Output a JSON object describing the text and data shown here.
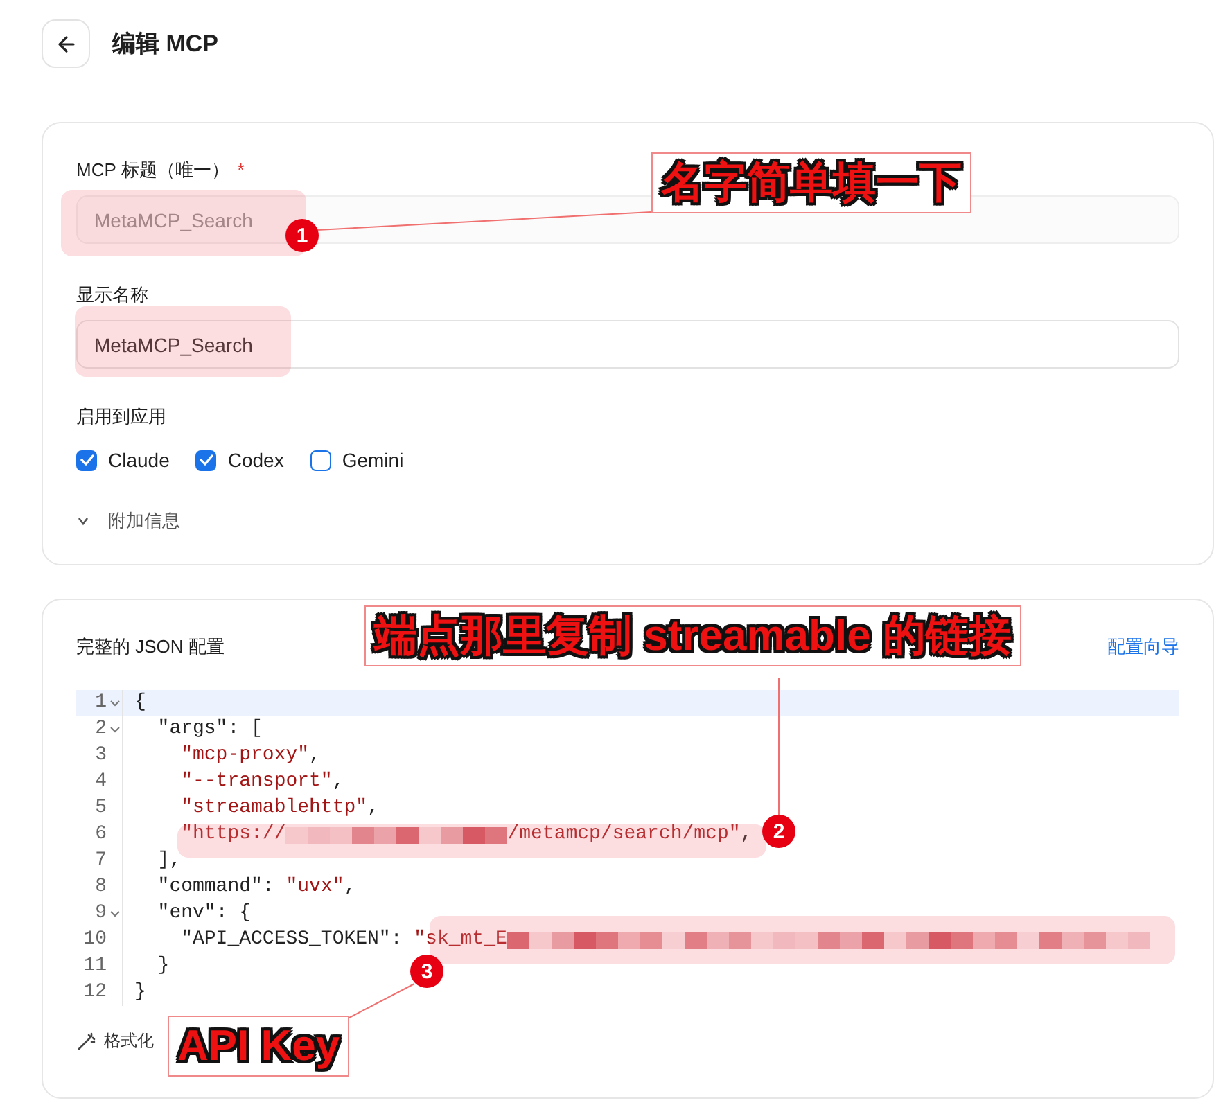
{
  "header": {
    "title": "编辑 MCP"
  },
  "form": {
    "fields": [
      {
        "label": "MCP 标题（唯一）",
        "required_mark": "*",
        "value": "MetaMCP_Search",
        "disabled": true
      },
      {
        "label": "显示名称",
        "value": "MetaMCP_Search",
        "disabled": false
      }
    ],
    "apps_label": "启用到应用",
    "apps": [
      {
        "label": "Claude",
        "checked": true
      },
      {
        "label": "Codex",
        "checked": true
      },
      {
        "label": "Gemini",
        "checked": false
      }
    ],
    "extra": {
      "label": "附加信息",
      "expanded": false
    }
  },
  "json_panel": {
    "title": "完整的 JSON 配置",
    "wizard_link": "配置向导",
    "lines": [
      {
        "n": "1",
        "fold": true,
        "highlighted": true,
        "tokens": [
          {
            "kind": "punct",
            "text": "{"
          }
        ]
      },
      {
        "n": "2",
        "fold": true,
        "highlighted": false,
        "tokens": [
          {
            "kind": "key",
            "text": "  \"args\""
          },
          {
            "kind": "punct",
            "text": ": ["
          }
        ]
      },
      {
        "n": "3",
        "fold": false,
        "highlighted": false,
        "tokens": [
          {
            "kind": "string",
            "text": "    \"mcp-proxy\""
          },
          {
            "kind": "punct",
            "text": ","
          }
        ]
      },
      {
        "n": "4",
        "fold": false,
        "highlighted": false,
        "tokens": [
          {
            "kind": "string",
            "text": "    \"--transport\""
          },
          {
            "kind": "punct",
            "text": ","
          }
        ]
      },
      {
        "n": "5",
        "fold": false,
        "highlighted": false,
        "tokens": [
          {
            "kind": "string",
            "text": "    \"streamablehttp\""
          },
          {
            "kind": "punct",
            "text": ","
          }
        ]
      },
      {
        "n": "6",
        "fold": false,
        "highlighted": false,
        "tokens": [
          {
            "kind": "string",
            "text": "    \"https://"
          },
          {
            "kind": "redacted"
          },
          {
            "kind": "string",
            "text": "/metamcp/search/mcp\""
          },
          {
            "kind": "punct",
            "text": ","
          }
        ]
      },
      {
        "n": "7",
        "fold": false,
        "highlighted": false,
        "tokens": [
          {
            "kind": "punct",
            "text": "  ],"
          }
        ]
      },
      {
        "n": "8",
        "fold": false,
        "highlighted": false,
        "tokens": [
          {
            "kind": "key",
            "text": "  \"command\""
          },
          {
            "kind": "punct",
            "text": ": "
          },
          {
            "kind": "string",
            "text": "\"uvx\""
          },
          {
            "kind": "punct",
            "text": ","
          }
        ]
      },
      {
        "n": "9",
        "fold": true,
        "highlighted": false,
        "tokens": [
          {
            "kind": "key",
            "text": "  \"env\""
          },
          {
            "kind": "punct",
            "text": ": {"
          }
        ]
      },
      {
        "n": "10",
        "fold": false,
        "highlighted": false,
        "tokens": [
          {
            "kind": "key",
            "text": "    \"API_ACCESS_TOKEN\""
          },
          {
            "kind": "punct",
            "text": ": "
          },
          {
            "kind": "string",
            "text": "\"sk_mt_E"
          },
          {
            "kind": "redacted"
          }
        ]
      },
      {
        "n": "11",
        "fold": false,
        "highlighted": false,
        "tokens": [
          {
            "kind": "punct",
            "text": "  }"
          }
        ]
      },
      {
        "n": "12",
        "fold": false,
        "highlighted": false,
        "tokens": [
          {
            "kind": "punct",
            "text": "}"
          }
        ]
      }
    ],
    "format_button": "格式化"
  },
  "annotations": [
    {
      "number": "1",
      "label": "名字简单填一下"
    },
    {
      "number": "2",
      "label": "端点那里复制 streamable 的链接"
    },
    {
      "number": "3",
      "label": "API Key"
    }
  ]
}
